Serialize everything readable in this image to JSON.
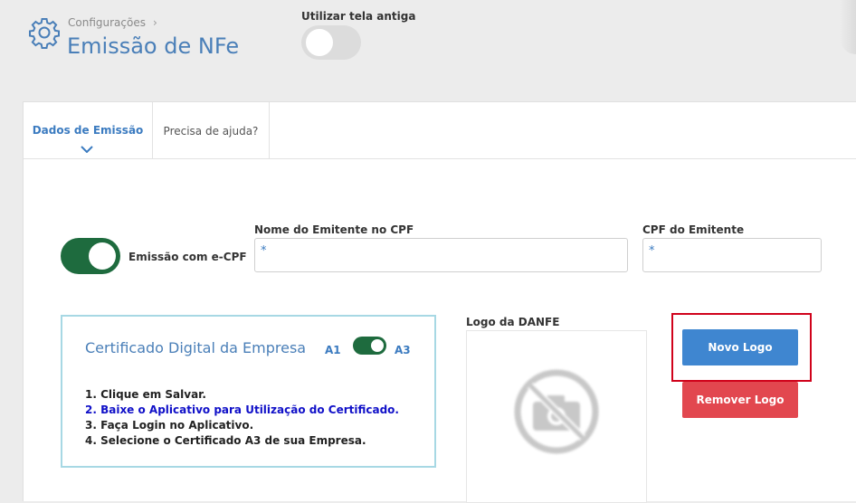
{
  "header": {
    "breadcrumb": "Configurações",
    "breadcrumb_sep": "›",
    "title": "Emissão de NFe",
    "old_screen_label": "Utilizar tela antiga",
    "old_screen_enabled": false
  },
  "tabs": [
    {
      "label": "Dados de Emissão",
      "active": true
    },
    {
      "label": "Precisa de ajuda?",
      "active": false
    }
  ],
  "form": {
    "ecpf_label": "Emissão com e-CPF",
    "ecpf_enabled": true,
    "emitente_nome_label": "Nome do Emitente no CPF",
    "emitente_nome_value": "*",
    "emitente_cpf_label": "CPF do Emitente",
    "emitente_cpf_value": "*"
  },
  "certificado": {
    "title": "Certificado Digital da Empresa",
    "a1_label": "A1",
    "a3_label": "A3",
    "a3_selected": true,
    "steps": [
      "1. Clique em Salvar.",
      "2. Baixe o Aplicativo para Utilização do Certificado.",
      "3. Faça Login no Aplicativo.",
      "4. Selecione o Certificado A3 de sua Empresa."
    ]
  },
  "logo": {
    "label": "Logo da DANFE",
    "novo_label": "Novo Logo",
    "remover_label": "Remover Logo"
  },
  "colors": {
    "accent": "#3b7bc0",
    "toggle_on": "#1e6b3e",
    "primary_button": "#3f86d0",
    "danger_button": "#e2474f",
    "highlight_border": "#d0021b"
  }
}
